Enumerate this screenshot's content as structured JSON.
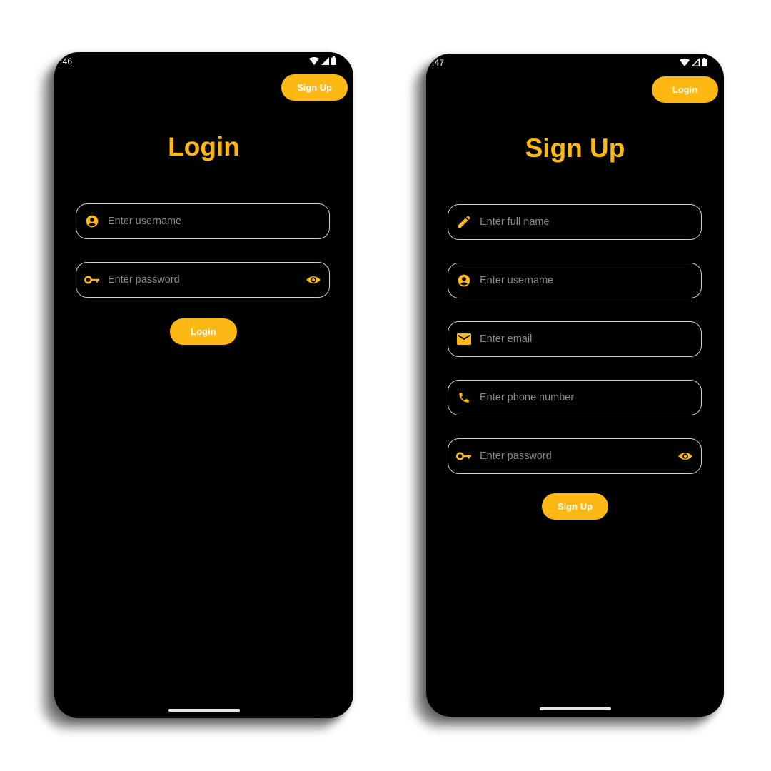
{
  "colors": {
    "accent": "#FDB813",
    "background": "#000000",
    "placeholder": "#8a8a8a",
    "field_border": "#cfcfcf"
  },
  "login_screen": {
    "status_time": ":46",
    "top_button_label": "Sign Up",
    "title": "Login",
    "fields": {
      "username": {
        "placeholder": "Enter username",
        "icon": "account-circle-icon"
      },
      "password": {
        "placeholder": "Enter password",
        "icon": "key-icon",
        "toggle_icon": "eye-icon"
      }
    },
    "submit_label": "Login"
  },
  "signup_screen": {
    "status_time": ":47",
    "top_button_label": "Login",
    "title": "Sign Up",
    "fields": {
      "full_name": {
        "placeholder": "Enter full name",
        "icon": "pencil-icon"
      },
      "username": {
        "placeholder": "Enter username",
        "icon": "account-circle-icon"
      },
      "email": {
        "placeholder": "Enter email",
        "icon": "mail-icon"
      },
      "phone": {
        "placeholder": "Enter phone number",
        "icon": "phone-icon"
      },
      "password": {
        "placeholder": "Enter password",
        "icon": "key-icon",
        "toggle_icon": "eye-icon"
      }
    },
    "submit_label": "Sign Up"
  }
}
